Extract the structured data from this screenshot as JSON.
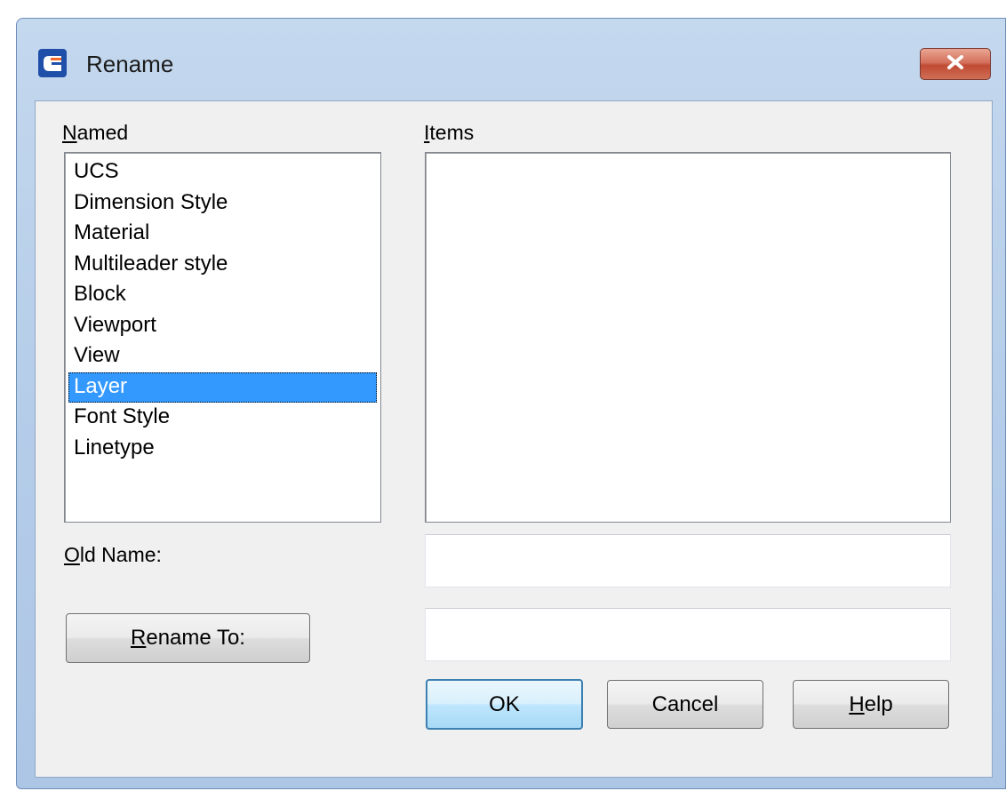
{
  "window": {
    "title": "Rename"
  },
  "named": {
    "label_mnemonic": "N",
    "label_rest": "amed",
    "items": [
      "UCS",
      "Dimension Style",
      "Material",
      "Multileader style",
      "Block",
      "Viewport",
      "View",
      "Layer",
      "Font Style",
      "Linetype"
    ],
    "selected": "Layer"
  },
  "items_list": {
    "label_mnemonic": "I",
    "label_rest": "tems"
  },
  "old_name": {
    "label_mnemonic": "O",
    "label_rest": "ld Name:",
    "value": ""
  },
  "rename_to": {
    "button_mnemonic": "R",
    "button_rest": "ename To:",
    "value": ""
  },
  "buttons": {
    "ok": "OK",
    "cancel": "Cancel",
    "help_mnemonic": "H",
    "help_rest": "elp"
  },
  "colors": {
    "selection": "#3399ff",
    "close_button": "#c9543c",
    "title_gradient": "#b5cde9"
  }
}
